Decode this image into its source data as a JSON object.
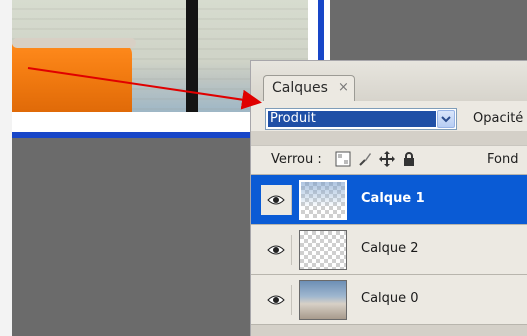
{
  "panel": {
    "tab_label": "Calques",
    "tab_close": "×",
    "blend_mode": "Produit",
    "opacity_label": "Opacité",
    "lock_label": "Verrou :",
    "fill_label": "Fond"
  },
  "layers": [
    {
      "name": "Calque 1",
      "visible": true,
      "selected": true
    },
    {
      "name": "Calque 2",
      "visible": true,
      "selected": false
    },
    {
      "name": "Calque 0",
      "visible": true,
      "selected": false
    }
  ],
  "colors": {
    "selection_blue": "#0a5bd5",
    "canvas_border_blue": "#1846c8",
    "annotation_red": "#e00000"
  },
  "icons": [
    "eye-icon",
    "lock-transparent-icon",
    "lock-brush-icon",
    "lock-move-icon",
    "lock-all-icon",
    "dropdown-arrow-icon",
    "close-icon"
  ]
}
